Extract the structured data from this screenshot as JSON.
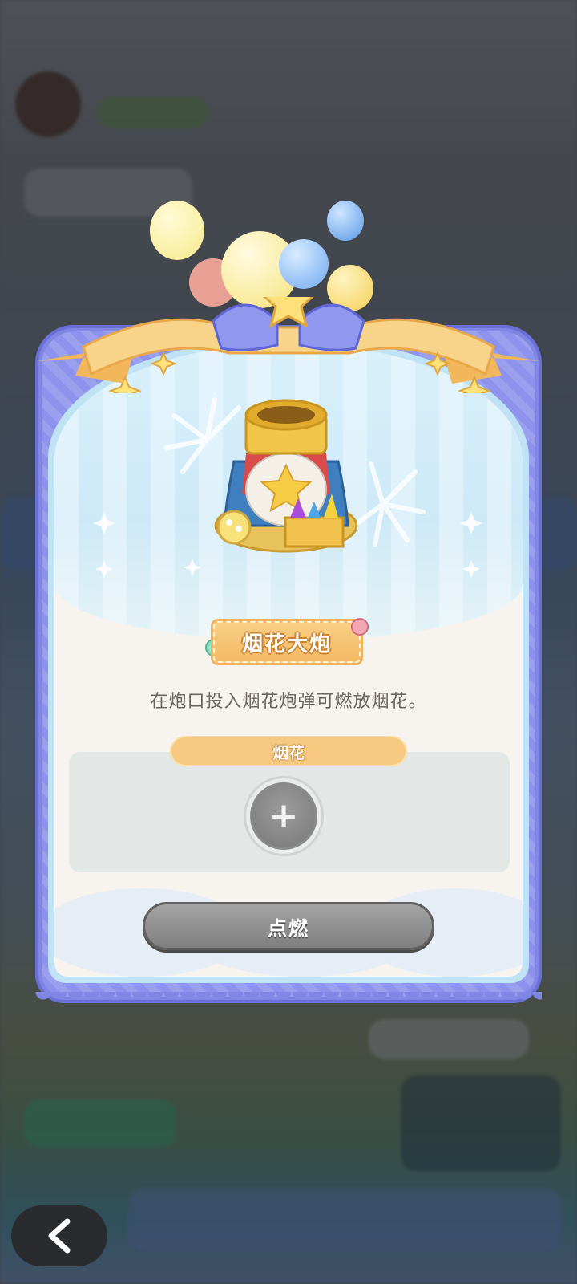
{
  "dialog": {
    "title": "烟花大炮",
    "description": "在炮口投入烟花炮弹可燃放烟花。",
    "slot_label": "烟花",
    "add_symbol": "+",
    "ignite_label": "点燃"
  },
  "icons": {
    "back": "chevron-left-icon",
    "add": "plus-icon",
    "item": "firework-cannon-icon"
  },
  "colors": {
    "frame": "#7f86e3",
    "title_banner": "#f3b965",
    "ignite_button": "#8f8f8f",
    "back_button": "#2a2b2f"
  }
}
